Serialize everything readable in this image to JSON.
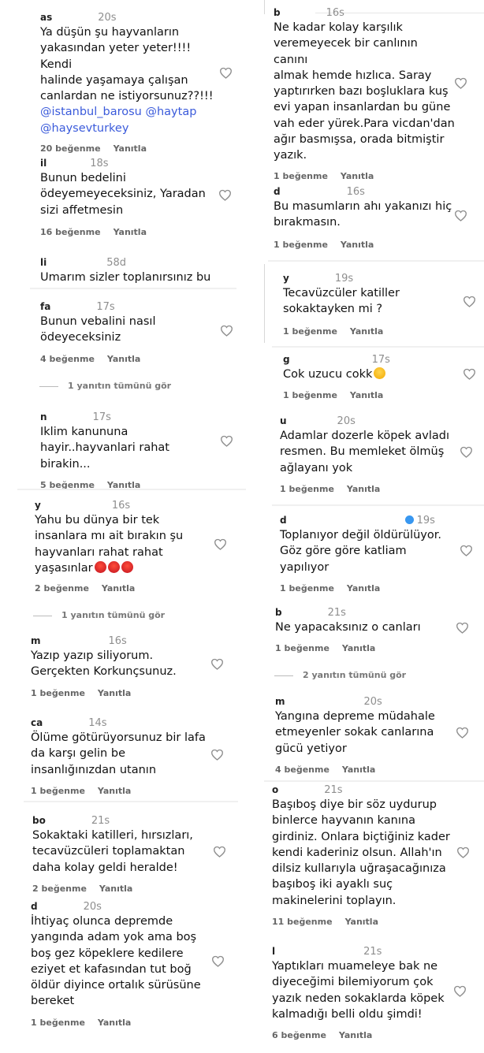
{
  "left": [
    {
      "user": "as",
      "time": "20s",
      "lines": [
        "Ya düşün şu hayvanların",
        "yakasından yeter yeter!!!! Kendi",
        "halinde yaşamaya çalışan",
        "canlardan ne istiyorsunuz??!!!"
      ],
      "mentions": [
        "@istanbul_barosu @haytap",
        "@haysevturkey"
      ],
      "likes": "20 beğenme",
      "reply": "Yanıtla"
    },
    {
      "user": "il",
      "time": "18s",
      "lines": [
        "Bunun bedelini",
        "ödeyemeyeceksiniz, Yaradan",
        "sizi affetmesin"
      ],
      "likes": "16 beğenme",
      "reply": "Yanıtla"
    },
    {
      "user": "li",
      "time": "58d",
      "lines": [
        "Umarım sizler toplanırsınız bu"
      ]
    },
    {
      "user": "fa",
      "time": "17s",
      "lines": [
        "Bunun vebalini nasıl",
        "ödeyeceksiniz"
      ],
      "likes": "4 beğenme",
      "reply": "Yanıtla",
      "more": "1 yanıtın tümünü gör"
    },
    {
      "user": "n",
      "time": "17s",
      "lines": [
        "Iklim kanununa",
        "hayir..hayvanlari rahat birakin..."
      ],
      "likes": "5 beğenme",
      "reply": "Yanıtla"
    },
    {
      "user": "y",
      "time": "16s",
      "lines": [
        "Yahu bu dünya bir tek",
        "insanlara mı ait bırakın şu",
        "hayvanları rahat rahat",
        "yaşasınlar"
      ],
      "likes": "2 beğenme",
      "reply": "Yanıtla",
      "more": "1 yanıtın tümünü gör"
    },
    {
      "user": "m",
      "time": "16s",
      "lines": [
        "Yazıp yazıp siliyorum.",
        "Gerçekten Korkunçsunuz."
      ],
      "likes": "1 beğenme",
      "reply": "Yanıtla"
    },
    {
      "user": "ca",
      "time": "14s",
      "lines": [
        "Ölüme götürüyorsunuz bir lafa",
        "da karşı gelin be",
        "insanlığınızdan utanın"
      ],
      "likes": "1 beğenme",
      "reply": "Yanıtla"
    },
    {
      "user": "bo",
      "time": "21s",
      "lines": [
        "Sokaktaki katilleri, hırsızları,",
        "tecavüzcüleri toplamaktan",
        "daha kolay geldi heralde!"
      ],
      "likes": "2 beğenme",
      "reply": "Yanıtla"
    },
    {
      "user": "d",
      "time": "20s",
      "lines": [
        "İhtiyaç olunca depremde",
        "yangında adam yok ama boş",
        "boş gez köpeklere kedilere",
        "eziyet et kafasından tut boğ",
        "öldür diyince ortalık sürüsüne",
        "bereket"
      ],
      "likes": "1 beğenme",
      "reply": "Yanıtla"
    }
  ],
  "right": [
    {
      "user": "b",
      "time": "16s",
      "lines": [
        "Ne kadar kolay karşılık",
        "veremeyecek bir canlının canını",
        "almak hemde hızlıca. Saray",
        "yaptırırken bazı boşluklara kuş",
        "evi yapan insanlardan bu güne",
        "vah eder yürek.Para vicdan'dan",
        "ağır basmışsa, orada bitmiştir",
        "yazık."
      ],
      "likes": "1 beğenme",
      "reply": "Yanıtla"
    },
    {
      "user": "d",
      "time": "16s",
      "lines": [
        "Bu masumların ahı yakanızı hiç",
        "bırakmasın."
      ],
      "likes": "1 beğenme",
      "reply": "Yanıtla"
    },
    {
      "user": "y",
      "time": "19s",
      "lines": [
        "Tecavüzcüler katiller",
        "sokaktayken mi ?"
      ],
      "likes": "1 beğenme",
      "reply": "Yanıtla"
    },
    {
      "user": "g",
      "time": "17s",
      "lines": [
        "Cok uzucu cokk"
      ],
      "likes": "1 beğenme",
      "reply": "Yanıtla"
    },
    {
      "user": "u",
      "time": "20s",
      "lines": [
        "Adamlar dozerle köpek avladı",
        "resmen. Bu memleket ölmüş",
        "ağlayanı yok"
      ],
      "likes": "1 beğenme",
      "reply": "Yanıtla"
    },
    {
      "user": "d",
      "time": "19s",
      "lines": [
        "Toplanıyor değil öldürülüyor.",
        "Göz göre göre katliam",
        "yapılıyor"
      ],
      "likes": "1 beğenme",
      "reply": "Yanıtla"
    },
    {
      "user": "b",
      "time": "21s",
      "lines": [
        "Ne yapacaksınız o canları"
      ],
      "likes": "1 beğenme",
      "reply": "Yanıtla",
      "more": "2 yanıtın tümünü gör"
    },
    {
      "user": "m",
      "time": "20s",
      "lines": [
        "Yangına depreme müdahale",
        "etmeyenler sokak canlarına",
        "gücü yetiyor"
      ],
      "likes": "4 beğenme",
      "reply": "Yanıtla"
    },
    {
      "user": "o",
      "time": "21s",
      "lines": [
        "Başıboş diye bir söz uydurup",
        "binlerce hayvanın kanına",
        "girdiniz. Onlara biçtiğiniz kader",
        "kendi kaderiniz olsun. Allah'ın",
        "dilsiz kullarıyla uğraşacağınıza",
        "başıboş iki ayaklı suç",
        "makinelerini toplayın."
      ],
      "likes": "11 beğenme",
      "reply": "Yanıtla"
    },
    {
      "user": "l",
      "time": "21s",
      "lines": [
        "Yaptıkları muameleye bak ne",
        "diyeceğimi bilemiyorum çok",
        "yazık neden sokaklarda köpek",
        "kalmadığı belli oldu şimdi!"
      ],
      "likes": "6 beğenme",
      "reply": "Yanıtla"
    }
  ],
  "icons": {
    "like": "heart-icon",
    "verified": "verified-badge-icon",
    "angry": "angry-face-emoji",
    "sad": "sad-face-emoji"
  }
}
